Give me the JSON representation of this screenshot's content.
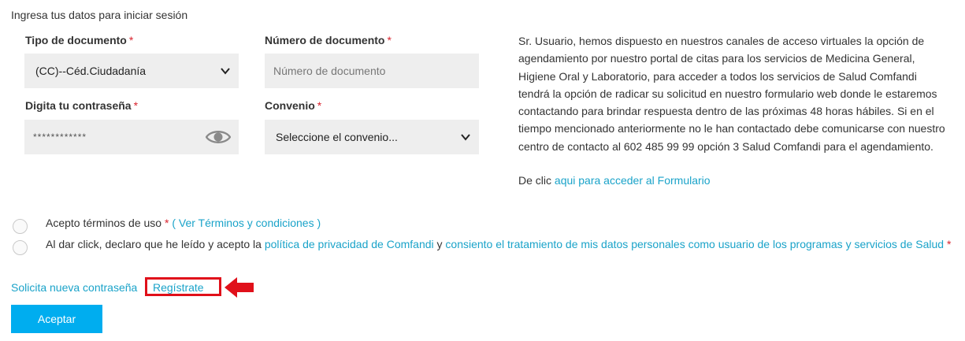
{
  "intro": "Ingresa tus datos para iniciar sesión",
  "form": {
    "doc_type_label": "Tipo de documento",
    "doc_type_value": "(CC)--Céd.Ciudadanía",
    "doc_number_label": "Número de documento",
    "doc_number_placeholder": "Número de documento",
    "password_label": "Digita tu contraseña",
    "password_value": "************",
    "agreement_label": "Convenio",
    "agreement_value": "Seleccione el convenio...",
    "required_mark": "*"
  },
  "notice": {
    "text": "Sr. Usuario, hemos dispuesto en nuestros canales de acceso virtuales la opción de agendamiento por nuestro portal de citas para los servicios de Medicina General, Higiene Oral y Laboratorio, para acceder a todos los servicios de Salud Comfandi tendrá la opción de radicar su solicitud en nuestro formulario web donde le estaremos contactando para brindar respuesta dentro de las próximas 48 horas hábiles. Si en el tiempo mencionado anteriormente no le han contactado debe comunicarse con nuestro centro de contacto al 602 485 99 99 opción 3 Salud Comfandi para el agendamiento.",
    "form_prefix": "De clic",
    "form_link": "aqui para acceder al Formulario"
  },
  "consent": {
    "terms_text": "Acepto términos de uso",
    "terms_link": "( Ver Términos y condiciones )",
    "privacy_prefix": "Al dar click, declaro que he leído y acepto la",
    "privacy_link": "política de privacidad de Comfandi",
    "privacy_and": "y",
    "data_link": "consiento el tratamiento de mis datos personales como usuario de los programas y servicios de Salud"
  },
  "links": {
    "new_password": "Solicita nueva contraseña",
    "register": "Regístrate"
  },
  "submit_label": "Aceptar",
  "colors": {
    "accent": "#00adef",
    "link": "#1aa3c9",
    "required": "#d9232e",
    "highlight_box": "#e0101a"
  }
}
